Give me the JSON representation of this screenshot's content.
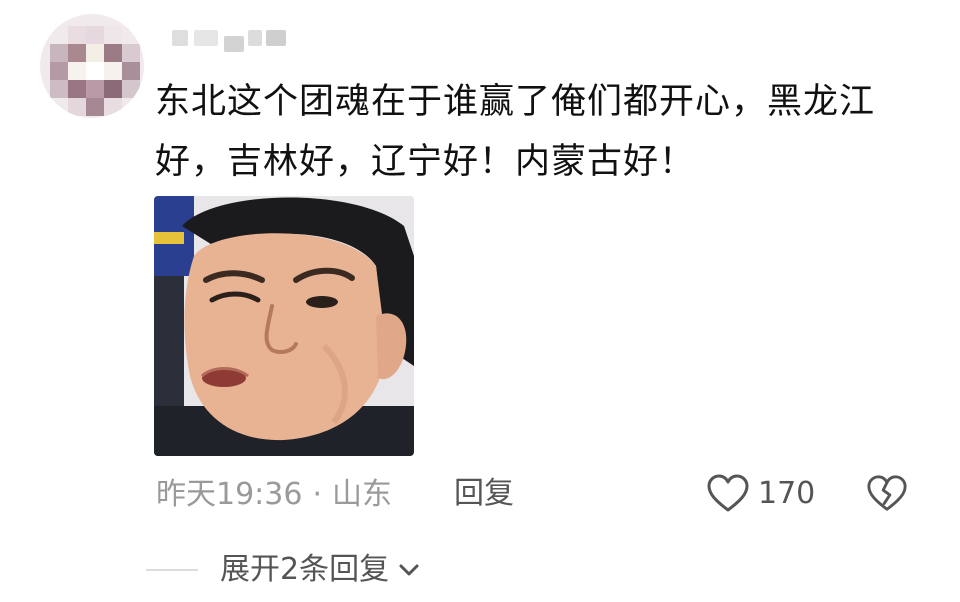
{
  "comment": {
    "text": "东北这个团魂在于谁赢了俺们都开心，黑龙江好，吉林好，辽宁好！内蒙古好！",
    "time": "昨天19:36",
    "separator": "·",
    "location": "山东",
    "reply_label": "回复",
    "like_count": "170",
    "expand_label": "展开2条回复"
  },
  "icons": {
    "avatar": "avatar-mosaic",
    "like": "heart-icon",
    "dislike": "broken-heart-icon",
    "expand": "chevron-down-icon"
  },
  "colors": {
    "text_primary": "#111111",
    "text_secondary": "#9a9a9a",
    "action_text": "#555555"
  }
}
